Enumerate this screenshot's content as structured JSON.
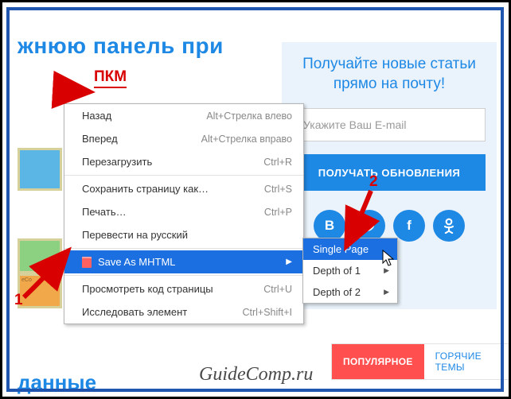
{
  "page": {
    "title_fragment": "жнюю панель при",
    "bottom_word_fragment": "данные"
  },
  "annotations": {
    "pkm": "ПКМ",
    "step1": "1",
    "step2": "2"
  },
  "sidebar": {
    "heading_line1": "Получайте новые статьи",
    "heading_line2": "прямо на почту!",
    "email_placeholder": "Укажите Ваш E-mail",
    "subscribe": "ПОЛУЧАТЬ ОБНОВЛЕНИЯ",
    "socials": {
      "vk": "B",
      "tw": "",
      "fb": "f",
      "ok": ""
    }
  },
  "tabs": {
    "popular": "ПОПУЛЯРНОЕ",
    "hot": "ГОРЯЧИЕ ТЕМЫ"
  },
  "context_menu": {
    "back": {
      "label": "Назад",
      "shortcut": "Alt+Стрелка влево"
    },
    "forward": {
      "label": "Вперед",
      "shortcut": "Alt+Стрелка вправо"
    },
    "reload": {
      "label": "Перезагрузить",
      "shortcut": "Ctrl+R"
    },
    "save_as": {
      "label": "Сохранить страницу как…",
      "shortcut": "Ctrl+S"
    },
    "print": {
      "label": "Печать…",
      "shortcut": "Ctrl+P"
    },
    "translate": {
      "label": "Перевести на русский",
      "shortcut": ""
    },
    "save_mhtml": {
      "label": "Save As MHTML",
      "shortcut": ""
    },
    "view_source": {
      "label": "Просмотреть код страницы",
      "shortcut": "Ctrl+U"
    },
    "inspect": {
      "label": "Исследовать элемент",
      "shortcut": "Ctrl+Shift+I"
    }
  },
  "submenu": {
    "single_page": "Single Page",
    "depth1": "Depth of 1",
    "depth2": "Depth of 2"
  },
  "watermark": "GuideComp.ru"
}
